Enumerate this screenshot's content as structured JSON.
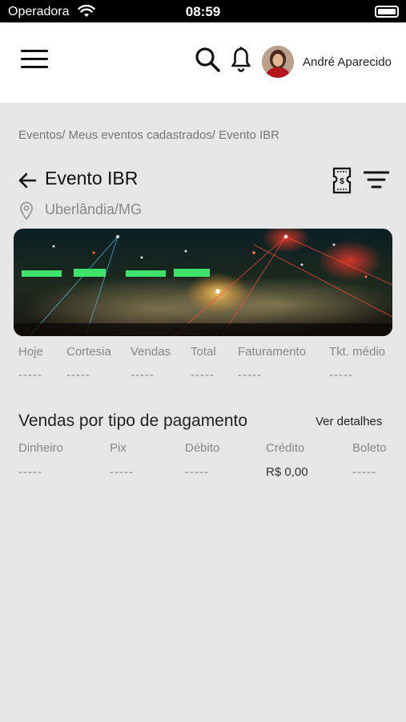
{
  "status_bar": {
    "carrier": "Operadora",
    "time": "08:59"
  },
  "header": {
    "user_name": "André Aparecido"
  },
  "breadcrumb": "Eventos/ Meus eventos cadastrados/ Evento IBR",
  "event": {
    "title": "Evento IBR",
    "location": "Uberlândia/MG"
  },
  "stats": [
    {
      "label": "Hoje",
      "value": "-----"
    },
    {
      "label": "Cortesia",
      "value": "-----"
    },
    {
      "label": "Vendas",
      "value": "-----"
    },
    {
      "label": "Total",
      "value": "-----"
    },
    {
      "label": "Faturamento",
      "value": "-----"
    },
    {
      "label": "Tkt. médio",
      "value": "-----"
    }
  ],
  "payments": {
    "title": "Vendas por tipo de pagamento",
    "details_link": "Ver detalhes",
    "items": [
      {
        "label": "Dinheiro",
        "value": "-----"
      },
      {
        "label": "Pix",
        "value": "-----"
      },
      {
        "label": "Débito",
        "value": "-----"
      },
      {
        "label": "Crédito",
        "value": "R$ 0,00"
      },
      {
        "label": "Boleto",
        "value": "-----"
      }
    ]
  }
}
